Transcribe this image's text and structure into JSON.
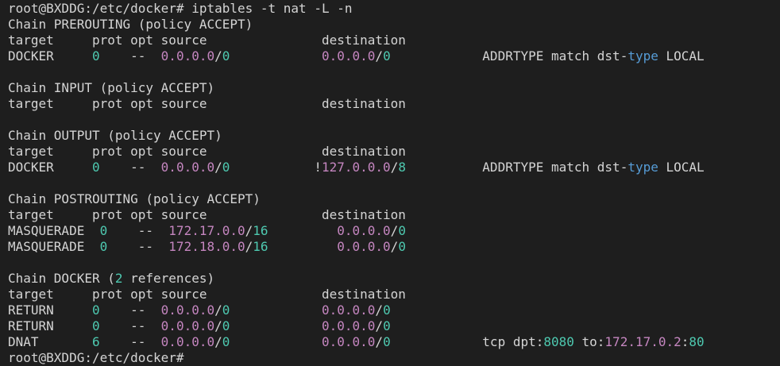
{
  "terminal": {
    "colors": {
      "background": "#1e1e1e",
      "text": "#d4d4d4",
      "number": "#4ec9b0",
      "ip_address": "#c586c0",
      "keyword": "#569cd6"
    },
    "lines": [
      [
        {
          "t": "root@BXDDG:/etc/docker# iptables -t nat -L -n"
        }
      ],
      [
        {
          "t": "Chain PREROUTING (policy ACCEPT)"
        }
      ],
      [
        {
          "t": "target     prot opt source               destination"
        }
      ],
      [
        {
          "t": "DOCKER     "
        },
        {
          "t": "0",
          "c": "num"
        },
        {
          "t": "    --  "
        },
        {
          "t": "0.0.0.0",
          "c": "ip"
        },
        {
          "t": "/"
        },
        {
          "t": "0",
          "c": "num"
        },
        {
          "t": "            "
        },
        {
          "t": "0.0.0.0",
          "c": "ip"
        },
        {
          "t": "/"
        },
        {
          "t": "0",
          "c": "num"
        },
        {
          "t": "            ADDRTYPE match dst-"
        },
        {
          "t": "type",
          "c": "kw"
        },
        {
          "t": " LOCAL"
        }
      ],
      [
        {
          "t": ""
        }
      ],
      [
        {
          "t": "Chain INPUT (policy ACCEPT)"
        }
      ],
      [
        {
          "t": "target     prot opt source               destination"
        }
      ],
      [
        {
          "t": ""
        }
      ],
      [
        {
          "t": "Chain OUTPUT (policy ACCEPT)"
        }
      ],
      [
        {
          "t": "target     prot opt source               destination"
        }
      ],
      [
        {
          "t": "DOCKER     "
        },
        {
          "t": "0",
          "c": "num"
        },
        {
          "t": "    --  "
        },
        {
          "t": "0.0.0.0",
          "c": "ip"
        },
        {
          "t": "/"
        },
        {
          "t": "0",
          "c": "num"
        },
        {
          "t": "           !"
        },
        {
          "t": "127.0.0.0",
          "c": "ip"
        },
        {
          "t": "/"
        },
        {
          "t": "8",
          "c": "num"
        },
        {
          "t": "          ADDRTYPE match dst-"
        },
        {
          "t": "type",
          "c": "kw"
        },
        {
          "t": " LOCAL"
        }
      ],
      [
        {
          "t": ""
        }
      ],
      [
        {
          "t": "Chain POSTROUTING (policy ACCEPT)"
        }
      ],
      [
        {
          "t": "target     prot opt source               destination"
        }
      ],
      [
        {
          "t": "MASQUERADE  "
        },
        {
          "t": "0",
          "c": "num"
        },
        {
          "t": "    --  "
        },
        {
          "t": "172.17.0.0",
          "c": "ip"
        },
        {
          "t": "/"
        },
        {
          "t": "16",
          "c": "num"
        },
        {
          "t": "         "
        },
        {
          "t": "0.0.0.0",
          "c": "ip"
        },
        {
          "t": "/"
        },
        {
          "t": "0",
          "c": "num"
        }
      ],
      [
        {
          "t": "MASQUERADE  "
        },
        {
          "t": "0",
          "c": "num"
        },
        {
          "t": "    --  "
        },
        {
          "t": "172.18.0.0",
          "c": "ip"
        },
        {
          "t": "/"
        },
        {
          "t": "16",
          "c": "num"
        },
        {
          "t": "         "
        },
        {
          "t": "0.0.0.0",
          "c": "ip"
        },
        {
          "t": "/"
        },
        {
          "t": "0",
          "c": "num"
        }
      ],
      [
        {
          "t": ""
        }
      ],
      [
        {
          "t": "Chain DOCKER ("
        },
        {
          "t": "2",
          "c": "num"
        },
        {
          "t": " references)"
        }
      ],
      [
        {
          "t": "target     prot opt source               destination"
        }
      ],
      [
        {
          "t": "RETURN     "
        },
        {
          "t": "0",
          "c": "num"
        },
        {
          "t": "    --  "
        },
        {
          "t": "0.0.0.0",
          "c": "ip"
        },
        {
          "t": "/"
        },
        {
          "t": "0",
          "c": "num"
        },
        {
          "t": "            "
        },
        {
          "t": "0.0.0.0",
          "c": "ip"
        },
        {
          "t": "/"
        },
        {
          "t": "0",
          "c": "num"
        }
      ],
      [
        {
          "t": "RETURN     "
        },
        {
          "t": "0",
          "c": "num"
        },
        {
          "t": "    --  "
        },
        {
          "t": "0.0.0.0",
          "c": "ip"
        },
        {
          "t": "/"
        },
        {
          "t": "0",
          "c": "num"
        },
        {
          "t": "            "
        },
        {
          "t": "0.0.0.0",
          "c": "ip"
        },
        {
          "t": "/"
        },
        {
          "t": "0",
          "c": "num"
        }
      ],
      [
        {
          "t": "DNAT       "
        },
        {
          "t": "6",
          "c": "num"
        },
        {
          "t": "    --  "
        },
        {
          "t": "0.0.0.0",
          "c": "ip"
        },
        {
          "t": "/"
        },
        {
          "t": "0",
          "c": "num"
        },
        {
          "t": "            "
        },
        {
          "t": "0.0.0.0",
          "c": "ip"
        },
        {
          "t": "/"
        },
        {
          "t": "0",
          "c": "num"
        },
        {
          "t": "            tcp dpt:"
        },
        {
          "t": "8080",
          "c": "num"
        },
        {
          "t": " to:"
        },
        {
          "t": "172.17.0.2",
          "c": "ip"
        },
        {
          "t": ":"
        },
        {
          "t": "80",
          "c": "num"
        }
      ],
      [
        {
          "t": "root@BXDDG:/etc/docker#"
        }
      ]
    ]
  }
}
